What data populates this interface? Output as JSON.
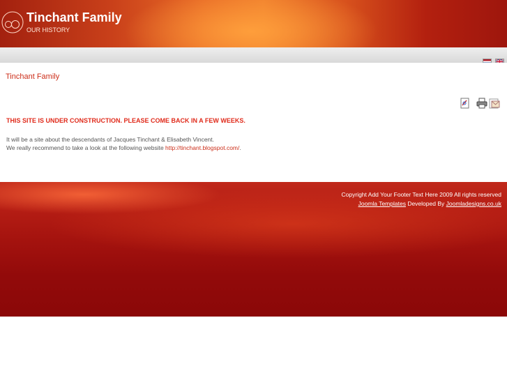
{
  "header": {
    "title": "Tinchant Family",
    "subtitle": "OUR HISTORY"
  },
  "languages": [
    "nl-flag-icon",
    "uk-flag-icon"
  ],
  "main": {
    "page_title": "Tinchant Family",
    "notice": "THIS SITE IS UNDER CONSTRUCTION. PLEASE COME BACK IN A FEW WEEKS.",
    "line1": "It will be a site about the descendants of Jacques Tinchant & Elisabeth Vincent.",
    "line2_prefix": "We really recommend to take a look at the following website ",
    "link": "http://tinchant.blogspot.com/",
    "line2_suffix": "."
  },
  "tools": [
    "pdf-icon",
    "print-icon",
    "email-icon"
  ],
  "footer": {
    "copyright": "Copyright Add Your Footer Text Here 2009 All rights reserved",
    "templates_link": "Joomla Templates",
    "developed_by": " Developed By ",
    "designer_link": "Joomladesigns.co.uk"
  },
  "colors": {
    "accent": "#cc2d18",
    "notice": "#e02a1a",
    "footer": "#a3120e"
  }
}
